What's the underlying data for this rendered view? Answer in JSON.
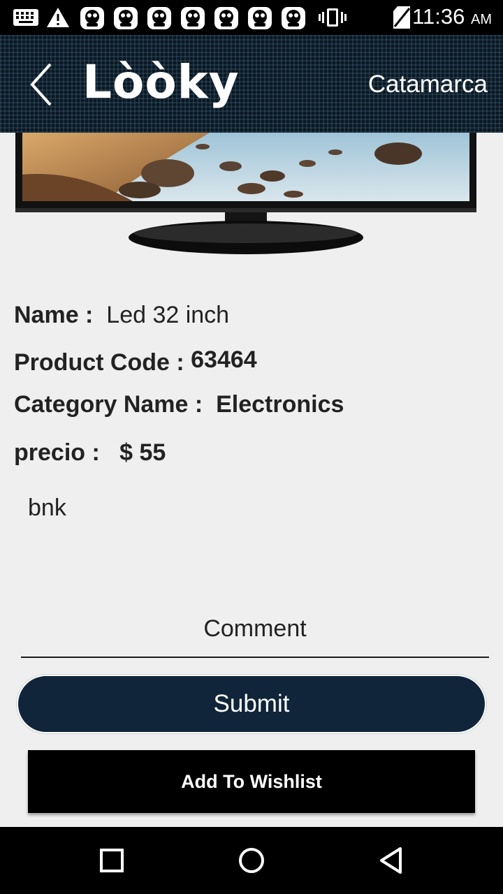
{
  "status_bar": {
    "time": "11:36",
    "ampm": "AM",
    "left_icons": [
      "keyboard-icon",
      "warning-icon",
      "app-icon",
      "app-icon",
      "app-icon",
      "app-icon",
      "app-icon",
      "app-icon",
      "app-icon"
    ],
    "right_icons": [
      "vibrate-icon",
      "no-sim-icon"
    ]
  },
  "header": {
    "logo_text": "Lòòky",
    "location": "Catamarca",
    "background_color": "#0b1822"
  },
  "product": {
    "image_alt": "LED television",
    "name_label": "Name :",
    "name_value": "Led 32 inch",
    "code_label": "Product Code :",
    "code_value": "63464",
    "category_label": "Category Name :",
    "category_value": "Electronics",
    "price_label": "precio :",
    "price_value": "$ 55",
    "description": "bnk"
  },
  "comment": {
    "placeholder": "Comment",
    "value": ""
  },
  "actions": {
    "submit_label": "Submit",
    "submit_color": "#10253a",
    "wishlist_label": "Add To Wishlist"
  },
  "nav": {
    "icons": [
      "recent-apps-icon",
      "home-icon",
      "back-icon"
    ]
  }
}
